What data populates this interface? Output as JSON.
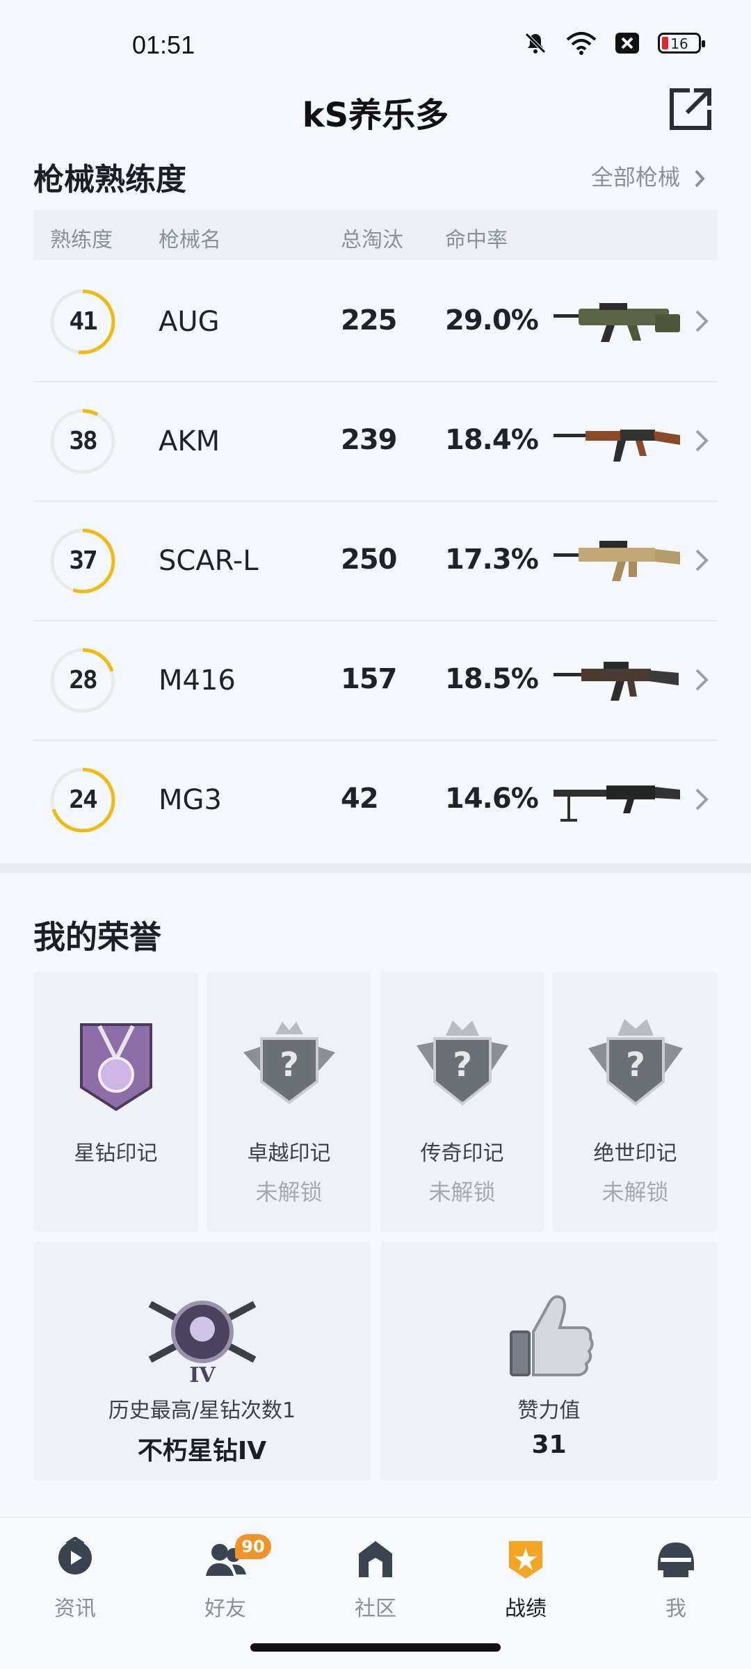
{
  "status_bar": {
    "time": "01:51",
    "battery_level": "16",
    "icons": [
      "mute-icon",
      "wifi-icon",
      "close-notification-icon",
      "battery-icon"
    ]
  },
  "header": {
    "title": "kS养乐多",
    "share_icon": "share-icon"
  },
  "weapons": {
    "title": "枪械熟练度",
    "view_all": "全部枪械",
    "columns": {
      "level": "熟练度",
      "name": "枪械名",
      "kills": "总淘汰",
      "accuracy": "命中率"
    },
    "rows": [
      {
        "level": "41",
        "progress": 0.52,
        "name": "AUG",
        "kills": "225",
        "accuracy": "29.0%",
        "icon": "aug-rifle-icon"
      },
      {
        "level": "38",
        "progress": 0.08,
        "name": "AKM",
        "kills": "239",
        "accuracy": "18.4%",
        "icon": "akm-rifle-icon"
      },
      {
        "level": "37",
        "progress": 0.55,
        "name": "SCAR-L",
        "kills": "250",
        "accuracy": "17.3%",
        "icon": "scar-rifle-icon"
      },
      {
        "level": "28",
        "progress": 0.2,
        "name": "M416",
        "kills": "157",
        "accuracy": "18.5%",
        "icon": "m416-rifle-icon"
      },
      {
        "level": "24",
        "progress": 0.7,
        "name": "MG3",
        "kills": "42",
        "accuracy": "14.6%",
        "icon": "mg3-gun-icon"
      }
    ]
  },
  "honors": {
    "title": "我的荣誉",
    "badges": [
      {
        "name": "星钻印记",
        "state": "",
        "icon": "star-diamond-medal-icon"
      },
      {
        "name": "卓越印记",
        "state": "未解锁",
        "icon": "locked-emblem-icon"
      },
      {
        "name": "传奇印记",
        "state": "未解锁",
        "icon": "locked-emblem-icon"
      },
      {
        "name": "绝世印记",
        "state": "未解锁",
        "icon": "locked-emblem-icon"
      }
    ],
    "rank_card": {
      "label": "历史最高/星钻次数1",
      "value": "不朽星钻IV",
      "icon": "rank-emblem-icon"
    },
    "likes_card": {
      "label": "赞力值",
      "value": "31",
      "icon": "thumbs-up-icon"
    }
  },
  "nav": {
    "items": [
      {
        "label": "资讯",
        "icon": "news-icon"
      },
      {
        "label": "好友",
        "icon": "friends-icon",
        "badge": "90"
      },
      {
        "label": "社区",
        "icon": "community-icon"
      },
      {
        "label": "战绩",
        "icon": "record-icon",
        "active": true
      },
      {
        "label": "我",
        "icon": "profile-helmet-icon"
      }
    ]
  },
  "colors": {
    "accent": "#f5b80f",
    "ring_track": "#e8eaee",
    "text": "#1f2329",
    "muted": "#8a9099",
    "badge": "#f1922a"
  }
}
